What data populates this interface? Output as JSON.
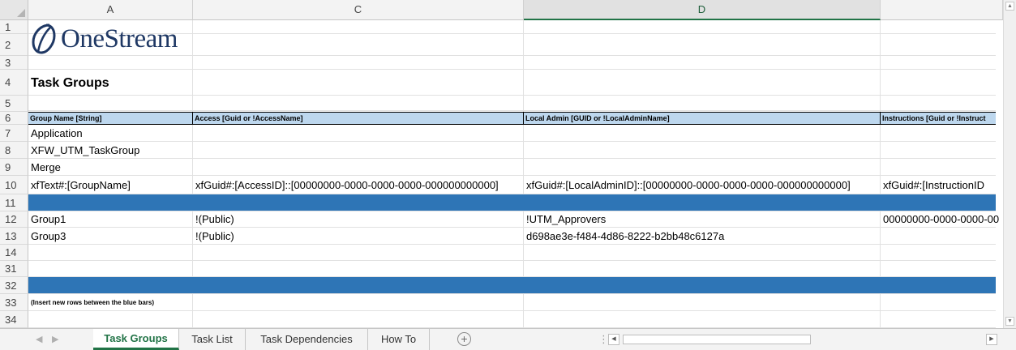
{
  "columns": [
    "A",
    "C",
    "D",
    ""
  ],
  "selected_column": "D",
  "row_numbers": [
    "1",
    "2",
    "3",
    "4",
    "5",
    "6",
    "7",
    "8",
    "9",
    "10",
    "11",
    "12",
    "13",
    "14",
    "31",
    "32",
    "33",
    "34"
  ],
  "logo": {
    "text": "OneStream"
  },
  "title": "Task Groups",
  "header_row": {
    "col_a": "Group Name [String]",
    "col_c": "Access [Guid or !AccessName]",
    "col_d": "Local Admin [GUID or !LocalAdminName]",
    "col_e": "Instructions [Guid or !Instruct"
  },
  "rows": {
    "r7": {
      "a": "Application"
    },
    "r8": {
      "a": "XFW_UTM_TaskGroup"
    },
    "r9": {
      "a": "Merge"
    },
    "r10": {
      "a": "xfText#:[GroupName]",
      "c": "xfGuid#:[AccessID]::[00000000-0000-0000-0000-000000000000]",
      "d": "xfGuid#:[LocalAdminID]::[00000000-0000-0000-0000-000000000000]",
      "e": "xfGuid#:[InstructionID"
    },
    "r12": {
      "a": "Group1",
      "c": "!(Public)",
      "d": "!UTM_Approvers",
      "e": "00000000-0000-0000-00"
    },
    "r13": {
      "a": "Group3",
      "c": "!(Public)",
      "d": "d698ae3e-f484-4d86-8222-b2bb48c6127a"
    },
    "r33": {
      "a": "(Insert new rows between the blue bars)"
    }
  },
  "tabs": [
    "Task Groups",
    "Task List",
    "Task Dependencies",
    "How To"
  ],
  "active_tab": "Task Groups",
  "colors": {
    "header_fill": "#bdd7ee",
    "blue_bar": "#2e75b6",
    "excel_green": "#217346"
  }
}
